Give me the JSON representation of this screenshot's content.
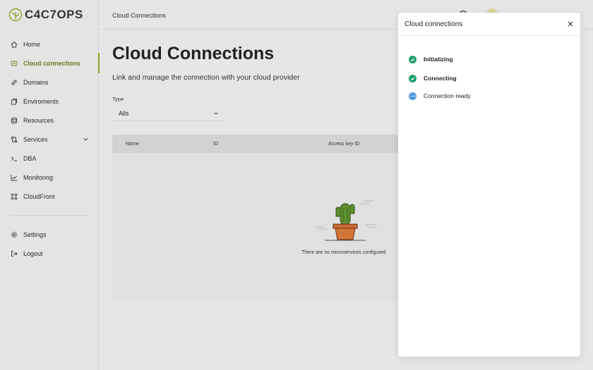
{
  "brand": {
    "name": "C4C7OPS"
  },
  "sidebar": {
    "items": [
      {
        "label": "Home",
        "icon": "home-icon"
      },
      {
        "label": "Cloud connections",
        "icon": "cloud-icon",
        "active": true
      },
      {
        "label": "Domains",
        "icon": "link-icon"
      },
      {
        "label": "Enviroments",
        "icon": "layers-icon"
      },
      {
        "label": "Resources",
        "icon": "database-icon"
      },
      {
        "label": "Services",
        "icon": "services-icon",
        "expandable": true
      },
      {
        "label": "DBA",
        "icon": "terminal-icon"
      },
      {
        "label": "Monitoring",
        "icon": "chart-icon"
      },
      {
        "label": "CloudFront",
        "icon": "grid-icon"
      }
    ],
    "bottom": [
      {
        "label": "Settings",
        "icon": "gear-icon"
      },
      {
        "label": "Logout",
        "icon": "logout-icon"
      }
    ]
  },
  "topbar": {
    "breadcrumb": "Cloud Connections"
  },
  "main": {
    "title": "Cloud Connections",
    "subtitle": "Link and manage the connection with your cloud provider",
    "filter": {
      "label": "Type",
      "value": "Alls"
    },
    "table": {
      "columns": [
        "Name",
        "ID",
        "Access key ID"
      ],
      "empty_text": "There are no microservices configured"
    }
  },
  "panel": {
    "title": "Cloud connections",
    "steps": [
      {
        "label": "Initializing",
        "status": "done"
      },
      {
        "label": "Connecting",
        "status": "done"
      },
      {
        "label": "Connection ready",
        "status": "pending"
      }
    ]
  },
  "colors": {
    "accent": "#8ea12b",
    "success": "#1e9d6a",
    "pending": "#4e9ae0"
  }
}
